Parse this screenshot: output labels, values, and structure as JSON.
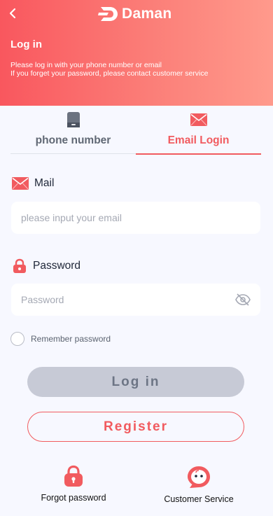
{
  "header": {
    "brand": "Daman",
    "title": "Log in",
    "description_line1": "Please log in with your phone number or email",
    "description_line2": "If you forget your password, please contact customer service"
  },
  "tabs": [
    {
      "label": "phone number",
      "icon": "phone-icon",
      "active": false
    },
    {
      "label": "Email Login",
      "icon": "mail-icon",
      "active": true
    }
  ],
  "form": {
    "mail_label": "Mail",
    "mail_placeholder": "please input your email",
    "mail_value": "",
    "password_label": "Password",
    "password_placeholder": "Password",
    "password_value": "",
    "remember_label": "Remember password",
    "remember_checked": false
  },
  "actions": {
    "login_label": "Log in",
    "register_label": "Register"
  },
  "bottom": {
    "forgot_label": "Forgot password",
    "service_label": "Customer Service"
  },
  "colors": {
    "accent": "#f15b5f",
    "header_start": "#f9575e",
    "header_end": "#ff9a8c",
    "background": "#f7f8ff",
    "login_button": "#c7cad6"
  }
}
